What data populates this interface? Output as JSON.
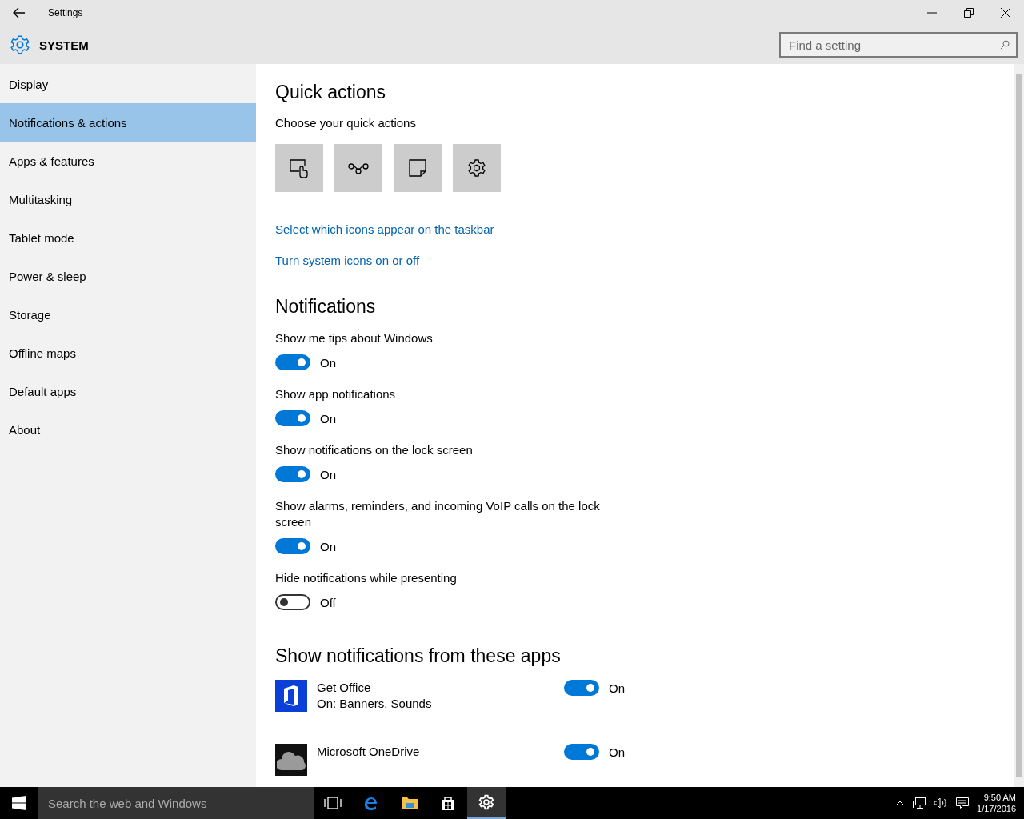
{
  "window": {
    "title": "Settings"
  },
  "header": {
    "title": "SYSTEM"
  },
  "search": {
    "placeholder": "Find a setting"
  },
  "sidebar": {
    "items": [
      {
        "label": "Display",
        "selected": false
      },
      {
        "label": "Notifications & actions",
        "selected": true
      },
      {
        "label": "Apps & features",
        "selected": false
      },
      {
        "label": "Multitasking",
        "selected": false
      },
      {
        "label": "Tablet mode",
        "selected": false
      },
      {
        "label": "Power & sleep",
        "selected": false
      },
      {
        "label": "Storage",
        "selected": false
      },
      {
        "label": "Offline maps",
        "selected": false
      },
      {
        "label": "Default apps",
        "selected": false
      },
      {
        "label": "About",
        "selected": false
      }
    ]
  },
  "quick_actions": {
    "title": "Quick actions",
    "subtitle": "Choose your quick actions"
  },
  "links": [
    "Select which icons appear on the taskbar",
    "Turn system icons on or off"
  ],
  "notifications": {
    "title": "Notifications",
    "settings": [
      {
        "label": "Show me tips about Windows",
        "on": true,
        "state": "On"
      },
      {
        "label": "Show app notifications",
        "on": true,
        "state": "On"
      },
      {
        "label": "Show notifications on the lock screen",
        "on": true,
        "state": "On"
      },
      {
        "label": "Show alarms, reminders, and incoming VoIP calls on the lock screen",
        "on": true,
        "state": "On"
      },
      {
        "label": "Hide notifications while presenting",
        "on": false,
        "state": "Off"
      }
    ]
  },
  "apps_section": {
    "title": "Show notifications from these apps",
    "apps": [
      {
        "kind": "office",
        "name": "Get Office",
        "detail": "On: Banners, Sounds",
        "on": true,
        "state": "On"
      },
      {
        "kind": "cloud",
        "name": "Microsoft OneDrive",
        "on": true,
        "state": "On"
      }
    ]
  },
  "taskbar": {
    "search_placeholder": "Search the web and Windows",
    "time": "9:50 AM",
    "date": "1/17/2016"
  }
}
